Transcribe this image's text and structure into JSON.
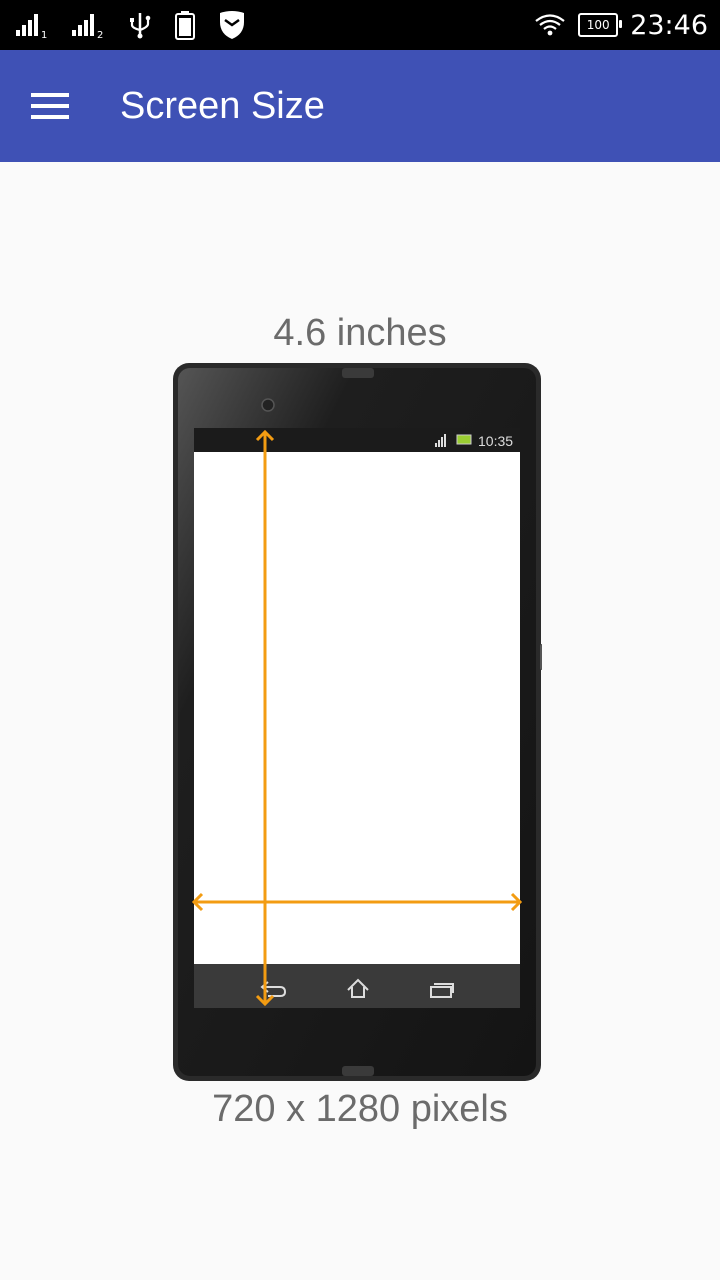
{
  "status_bar": {
    "sim1_label": "1",
    "sim2_label": "2",
    "battery_level": "100",
    "time": "23:46",
    "notification_icons": [
      "signal-sim1-icon",
      "signal-sim2-icon",
      "usb-icon",
      "battery-notification-icon",
      "shield-icon"
    ],
    "system_icons": [
      "wifi-icon",
      "battery-icon"
    ]
  },
  "app_bar": {
    "title": "Screen Size",
    "menu_icon": "hamburger-menu-icon",
    "color": "#3F51B5"
  },
  "screen_info": {
    "diagonal": "4.6 inches",
    "resolution": "720 x 1280 pixels"
  },
  "illustration": {
    "mini_time": "10:35",
    "arrow_color": "#F39C12",
    "nav_icons": [
      "back-icon",
      "home-icon",
      "recent-apps-icon"
    ]
  }
}
